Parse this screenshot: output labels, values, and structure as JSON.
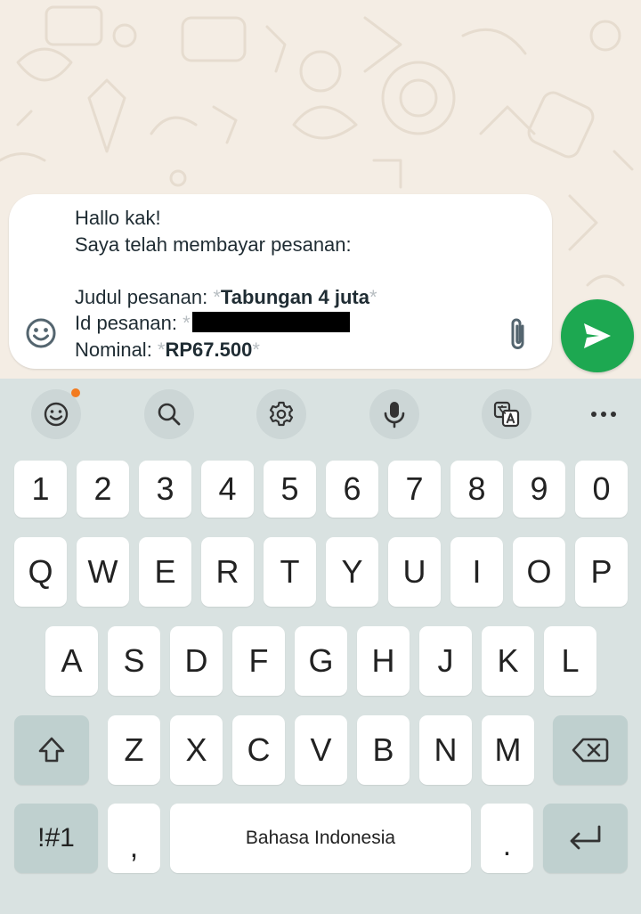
{
  "message": {
    "lines": [
      "Hallo kak!",
      "Saya telah membayar pesanan:",
      "",
      "Judul pesanan: ",
      "Id pesanan: ",
      "Nominal: "
    ],
    "star": "*",
    "title_value": "Tabungan 4 juta",
    "amount_value": "RP67.500"
  },
  "composer": {
    "emoji_icon": "emoji-icon",
    "attach_icon": "paperclip-icon",
    "send_icon": "send-icon",
    "send_color": "#1da851"
  },
  "keyboard": {
    "toolbar": [
      "emoji-icon",
      "search-icon",
      "gear-icon",
      "microphone-icon",
      "translate-icon",
      "more-icon"
    ],
    "number_row": [
      "1",
      "2",
      "3",
      "4",
      "5",
      "6",
      "7",
      "8",
      "9",
      "0"
    ],
    "row1": [
      "Q",
      "W",
      "E",
      "R",
      "T",
      "Y",
      "U",
      "I",
      "O",
      "P"
    ],
    "row2": [
      "A",
      "S",
      "D",
      "F",
      "G",
      "H",
      "J",
      "K",
      "L"
    ],
    "row3": [
      "Z",
      "X",
      "C",
      "V",
      "B",
      "N",
      "M"
    ],
    "symbols_label": "!#1",
    "comma_label": ",",
    "space_label": "Bahasa Indonesia",
    "period_label": ".",
    "shift_icon": "shift-icon",
    "backspace_icon": "backspace-icon",
    "enter_icon": "enter-icon"
  }
}
